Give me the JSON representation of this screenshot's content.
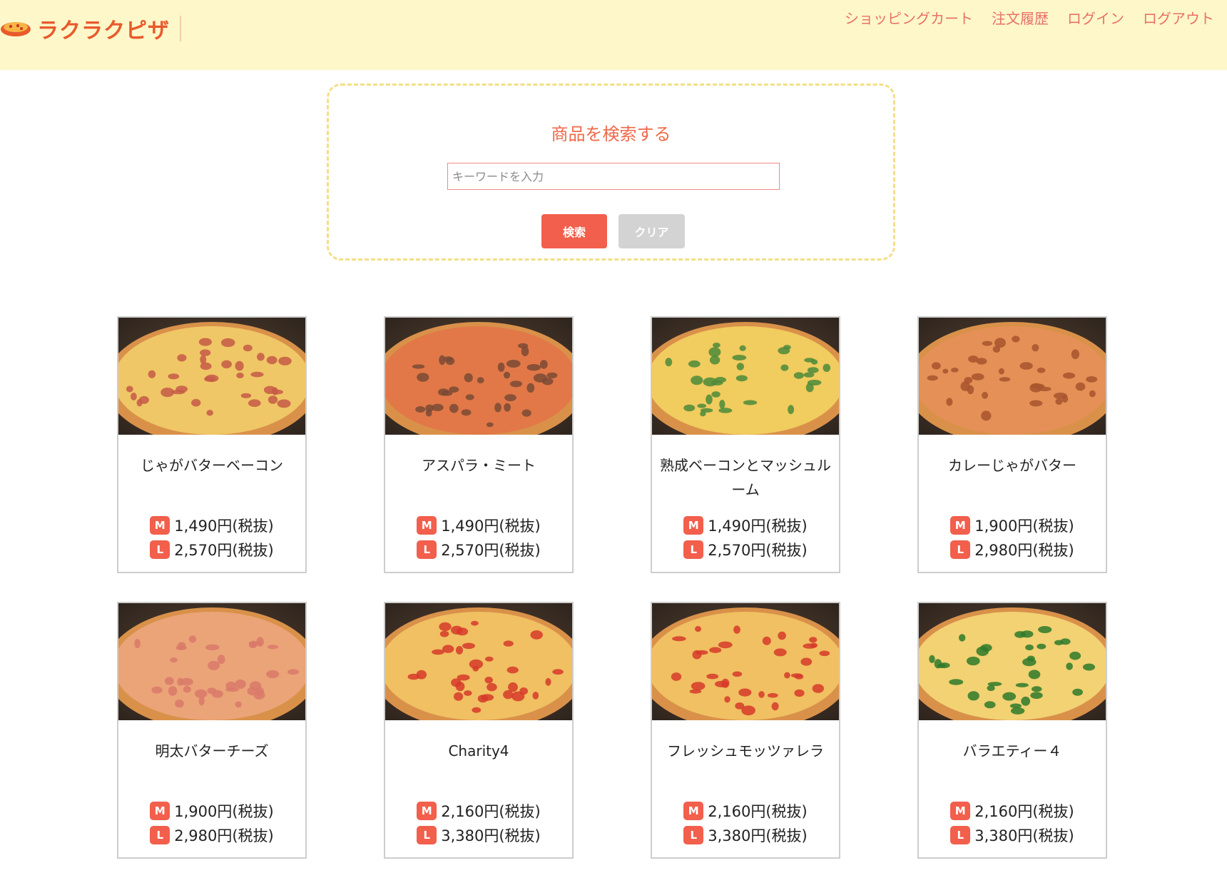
{
  "site": {
    "logo_text": "ラクラクピザ"
  },
  "nav": [
    {
      "label": "ショッピングカート"
    },
    {
      "label": "注文履歴"
    },
    {
      "label": "ログイン"
    },
    {
      "label": "ログアウト"
    }
  ],
  "search": {
    "title": "商品を検索する",
    "placeholder": "キーワードを入力",
    "value": "",
    "search_label": "検索",
    "clear_label": "クリア"
  },
  "size_labels": {
    "m": "M",
    "l": "L"
  },
  "products": [
    {
      "name": "じゃがバターベーコン",
      "price_m": "1,490円(税抜)",
      "price_l": "2,570円(税抜)",
      "topping_color": "#c55a48",
      "cheese_color": "#f0c766"
    },
    {
      "name": "アスパラ・ミート",
      "price_m": "1,490円(税抜)",
      "price_l": "2,570円(税抜)",
      "topping_color": "#7a4a35",
      "cheese_color": "#e27848"
    },
    {
      "name": "熟成ベーコンとマッシュルーム",
      "price_m": "1,490円(税抜)",
      "price_l": "2,570円(税抜)",
      "topping_color": "#4c8a3a",
      "cheese_color": "#f1cc5e"
    },
    {
      "name": "カレーじゃがバター",
      "price_m": "1,900円(税抜)",
      "price_l": "2,980円(税抜)",
      "topping_color": "#a8552e",
      "cheese_color": "#e59056"
    },
    {
      "name": "明太バターチーズ",
      "price_m": "1,900円(税抜)",
      "price_l": "2,980円(税抜)",
      "topping_color": "#d97a6a",
      "cheese_color": "#eba478"
    },
    {
      "name": "Charity4",
      "price_m": "2,160円(税抜)",
      "price_l": "3,380円(税抜)",
      "topping_color": "#d63a2a",
      "cheese_color": "#f0c062"
    },
    {
      "name": "フレッシュモッツァレラ",
      "price_m": "2,160円(税抜)",
      "price_l": "3,380円(税抜)",
      "topping_color": "#d63a2a",
      "cheese_color": "#f0c062"
    },
    {
      "name": "バラエティー４",
      "price_m": "2,160円(税抜)",
      "price_l": "3,380円(税抜)",
      "topping_color": "#2f7a2a",
      "cheese_color": "#f2d273"
    }
  ]
}
